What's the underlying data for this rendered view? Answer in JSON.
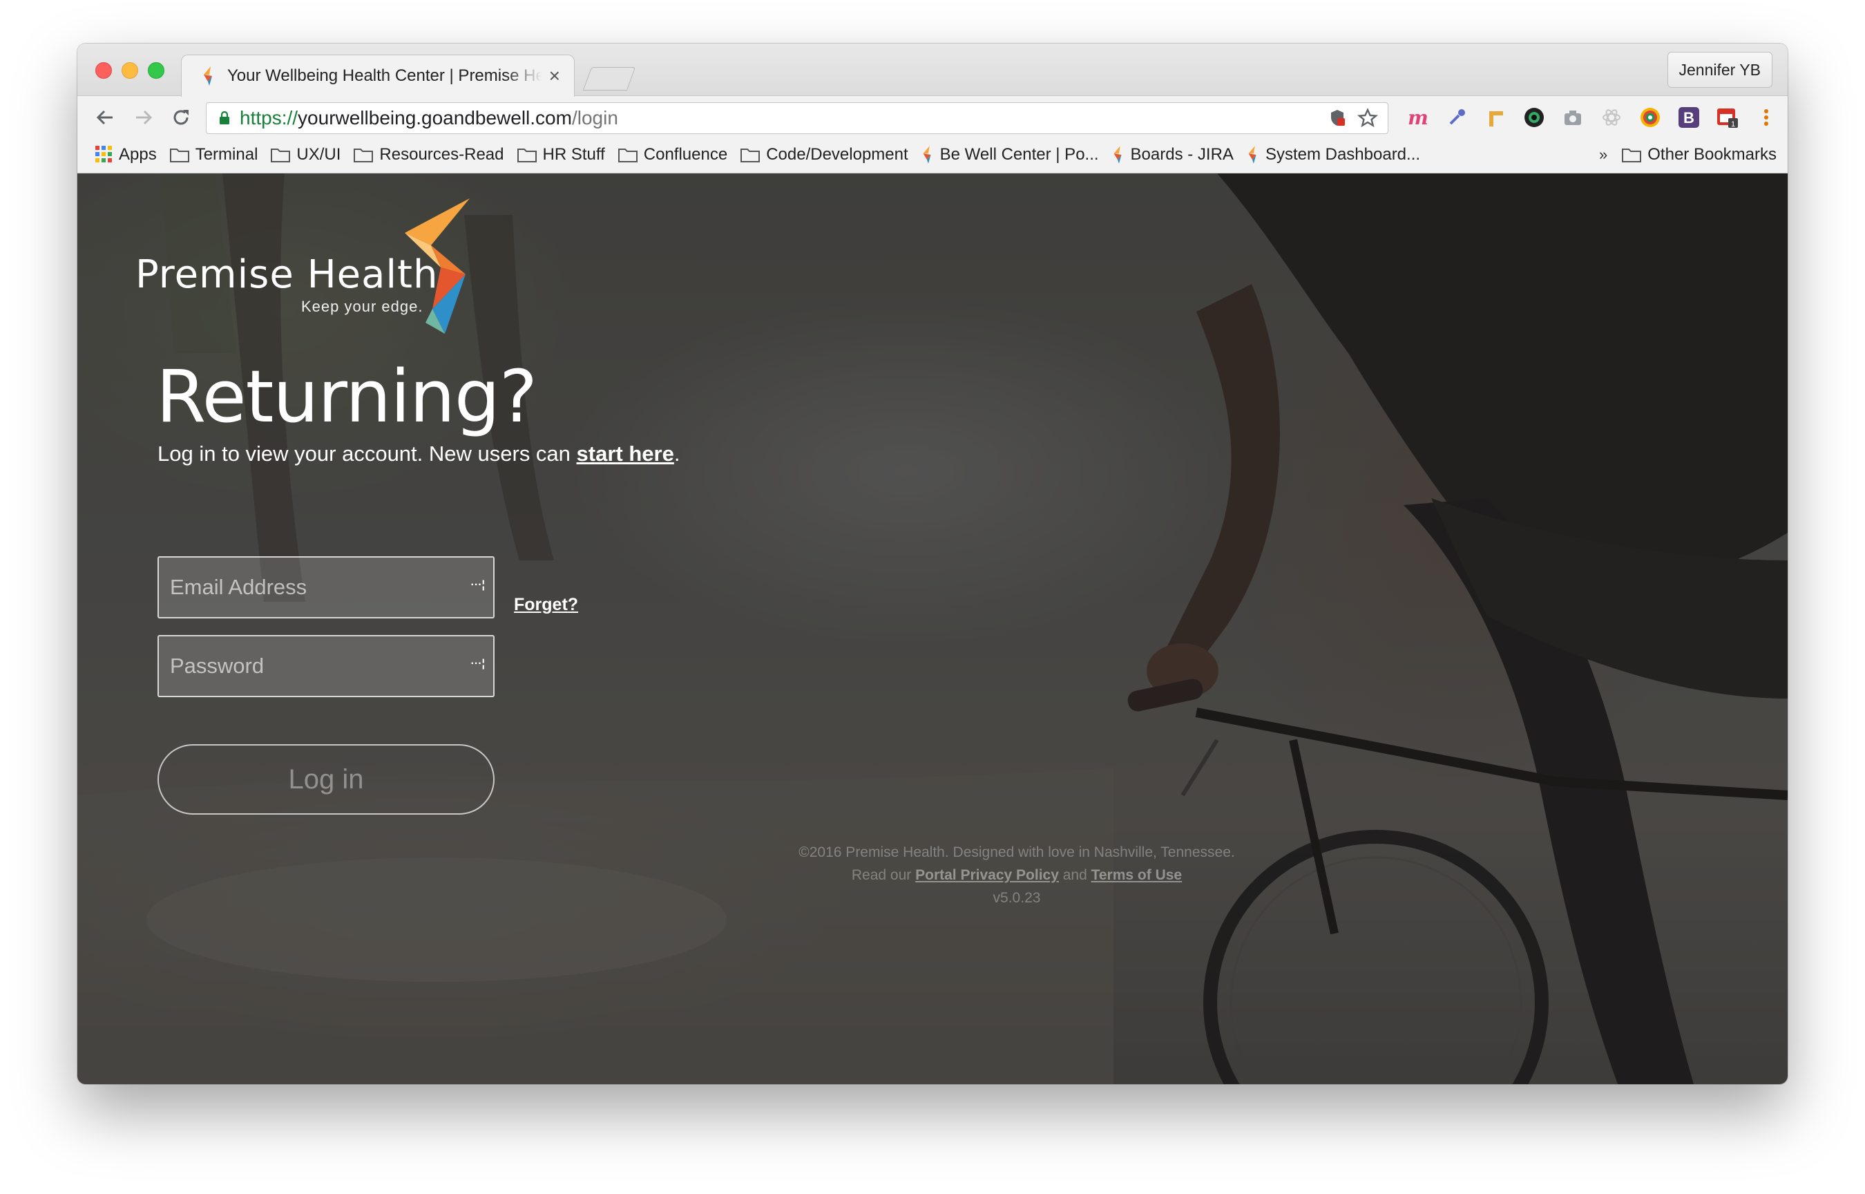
{
  "browser": {
    "tab_title": "Your Wellbeing Health Center | Premise Health",
    "profile_name": "Jennifer YB",
    "url": {
      "scheme": "https://",
      "host": "yourwellbeing.goandbewell.com",
      "path": "/login"
    },
    "bookmarks": [
      {
        "label": "Apps",
        "icon": "apps-grid-icon"
      },
      {
        "label": "Terminal",
        "icon": "folder-icon"
      },
      {
        "label": "UX/UI",
        "icon": "folder-icon"
      },
      {
        "label": "Resources-Read",
        "icon": "folder-icon"
      },
      {
        "label": "HR Stuff",
        "icon": "folder-icon"
      },
      {
        "label": "Confluence",
        "icon": "folder-icon"
      },
      {
        "label": "Code/Development",
        "icon": "folder-icon"
      },
      {
        "label": "Be Well Center | Po...",
        "icon": "premise-favicon"
      },
      {
        "label": "Boards - JIRA",
        "icon": "premise-favicon"
      },
      {
        "label": "System Dashboard...",
        "icon": "premise-favicon"
      }
    ],
    "bookmarks_overflow": "»",
    "other_bookmarks": "Other Bookmarks",
    "accent_colors": {
      "secure": "#188038"
    }
  },
  "brand": {
    "name": "Premise Health",
    "tagline": "Keep your edge."
  },
  "login": {
    "heading": "Returning?",
    "subtitle_prefix": "Log in to view your account. New users can ",
    "subtitle_link": "start here",
    "subtitle_suffix": ".",
    "email_placeholder": "Email Address",
    "password_placeholder": "Password",
    "forget_link": "Forget?",
    "login_button": "Log in"
  },
  "footer": {
    "copyright": "©2016 Premise Health. Designed with love in Nashville, Tennessee.",
    "read_prefix": "Read our ",
    "privacy_link": "Portal Privacy Policy",
    "and_text": " and ",
    "terms_link": "Terms of Use",
    "version": "v5.0.23"
  }
}
